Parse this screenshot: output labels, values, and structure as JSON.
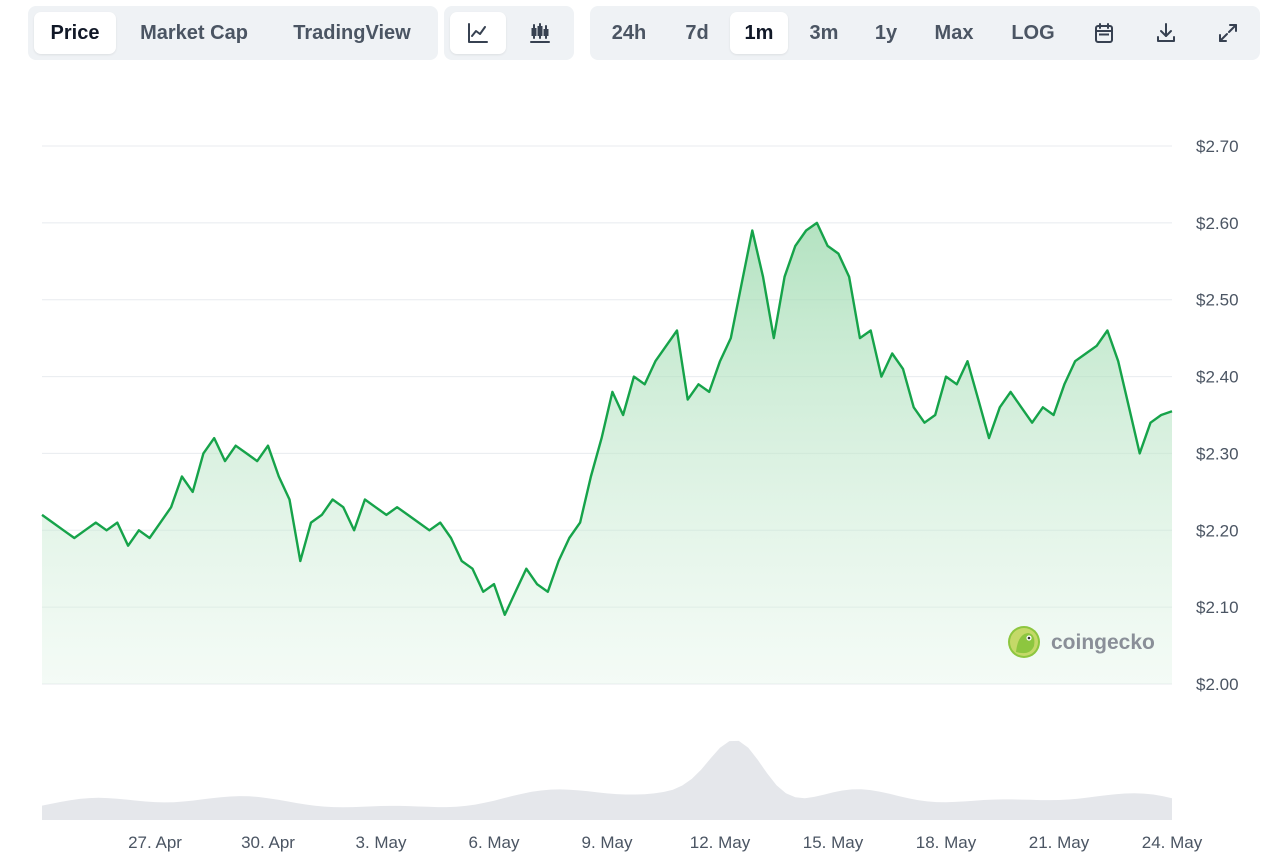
{
  "tabs": {
    "data_type": [
      {
        "label": "Price",
        "active": true
      },
      {
        "label": "Market Cap",
        "active": false
      },
      {
        "label": "TradingView",
        "active": false
      }
    ],
    "chart_style": [
      {
        "icon": "line-chart-icon",
        "active": true
      },
      {
        "icon": "candlestick-icon",
        "active": false
      }
    ],
    "ranges": [
      {
        "label": "24h",
        "active": false
      },
      {
        "label": "7d",
        "active": false
      },
      {
        "label": "1m",
        "active": true
      },
      {
        "label": "3m",
        "active": false
      },
      {
        "label": "1y",
        "active": false
      },
      {
        "label": "Max",
        "active": false
      },
      {
        "label": "LOG",
        "active": false
      }
    ],
    "tools": [
      "calendar-icon",
      "download-icon",
      "expand-icon"
    ]
  },
  "watermark": "coingecko",
  "colors": {
    "line": "#16a34a",
    "fill_top": "#9ad9ac",
    "grid": "#e8ebef",
    "volume": "#e5e7eb",
    "toolbar_bg": "#eff2f5"
  },
  "chart_data": {
    "type": "area",
    "title": "",
    "xlabel": "",
    "ylabel": "",
    "ylim": [
      2.0,
      2.7
    ],
    "yticks": [
      "$2.70",
      "$2.60",
      "$2.50",
      "$2.40",
      "$2.30",
      "$2.20",
      "$2.10",
      "$2.00"
    ],
    "xticks": [
      "27. Apr",
      "30. Apr",
      "3. May",
      "6. May",
      "9. May",
      "12. May",
      "15. May",
      "18. May",
      "21. May",
      "24. May"
    ],
    "grid": true,
    "x_start": "2025-04-24",
    "x_end": "2025-05-24",
    "series": [
      {
        "values": [
          2.22,
          2.21,
          2.2,
          2.19,
          2.2,
          2.21,
          2.2,
          2.21,
          2.18,
          2.2,
          2.19,
          2.21,
          2.23,
          2.27,
          2.25,
          2.3,
          2.32,
          2.29,
          2.31,
          2.3,
          2.29,
          2.31,
          2.27,
          2.24,
          2.16,
          2.21,
          2.22,
          2.24,
          2.23,
          2.2,
          2.24,
          2.23,
          2.22,
          2.23,
          2.22,
          2.21,
          2.2,
          2.21,
          2.19,
          2.16,
          2.15,
          2.12,
          2.13,
          2.09,
          2.12,
          2.15,
          2.13,
          2.12,
          2.16,
          2.19,
          2.21,
          2.27,
          2.32,
          2.38,
          2.35,
          2.4,
          2.39,
          2.42,
          2.44,
          2.46,
          2.37,
          2.39,
          2.38,
          2.42,
          2.45,
          2.52,
          2.59,
          2.53,
          2.45,
          2.53,
          2.57,
          2.59,
          2.6,
          2.57,
          2.56,
          2.53,
          2.45,
          2.46,
          2.4,
          2.43,
          2.41,
          2.36,
          2.34,
          2.35,
          2.4,
          2.39,
          2.42,
          2.37,
          2.32,
          2.36,
          2.38,
          2.36,
          2.34,
          2.36,
          2.35,
          2.39,
          2.42,
          2.43,
          2.44,
          2.46,
          2.42,
          2.36,
          2.3,
          2.34,
          2.35,
          2.355
        ]
      }
    ],
    "volume_band": "shown"
  }
}
